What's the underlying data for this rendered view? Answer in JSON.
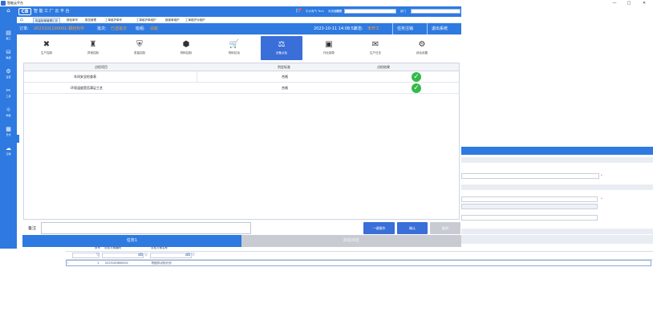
{
  "window": {
    "title": "智能云平台",
    "controls": [
      "—",
      "□",
      "✕"
    ]
  },
  "header": {
    "logo": "CB",
    "app_title": "智 能 工 厂 云 平 台",
    "tenant_text": "中大电气 Tech",
    "lang_text": "系统管理员",
    "org_label": "组织",
    "role_label": "部门"
  },
  "nav": {
    "tabs": [
      {
        "label": "批量制单管理汇总"
      },
      {
        "label": "报检单号"
      },
      {
        "label": "数控管理"
      },
      {
        "label": "工单维护单号"
      },
      {
        "label": "工单维护单维护"
      },
      {
        "label": "报废单维护"
      },
      {
        "label": "工单维护分维护"
      }
    ]
  },
  "status": {
    "order_label": "订单:",
    "order_value": "2023101100001-钢结构件",
    "batch_label": "批次:",
    "batch_value": "已选批次",
    "team_label": "班组:",
    "team_value": "白班",
    "datetime": "2023-10-11 14:08:52",
    "state_label": "状态:",
    "state_value": "未开工",
    "task_logout": "任务注销",
    "exit_system": "退出系统"
  },
  "sidebar": {
    "items": [
      {
        "icon": "⌂",
        "label": ""
      },
      {
        "icon": "▤",
        "label": "报工"
      },
      {
        "icon": "⛁",
        "label": "数据"
      },
      {
        "icon": "⚙",
        "label": "设置"
      },
      {
        "icon": "✂",
        "label": "工具"
      },
      {
        "icon": "☼",
        "label": "参数"
      },
      {
        "icon": "▦",
        "label": "日志"
      },
      {
        "icon": "☁",
        "label": "云端"
      }
    ]
  },
  "tiles": [
    {
      "icon": "✖",
      "label": "生产控制"
    },
    {
      "icon": "♜",
      "label": "异常控制"
    },
    {
      "icon": "⛨",
      "label": "质量控制"
    },
    {
      "icon": "⬢",
      "label": "物料控制"
    },
    {
      "icon": "🛒",
      "label": "物料拉动"
    },
    {
      "icon": "⚖",
      "label": "设备点检"
    },
    {
      "icon": "▣",
      "label": "作业指导"
    },
    {
      "icon": "✉",
      "label": "生产日志"
    },
    {
      "icon": "⚙",
      "label": "综合设置"
    }
  ],
  "table": {
    "columns": [
      "点检项目",
      "判定标准",
      "点检结果"
    ],
    "rows": [
      {
        "item": "车间安全检查表",
        "standard": "合格",
        "result": "ok"
      },
      {
        "item": "环境温度是否满足工艺",
        "standard": "合格",
        "result": "ok"
      }
    ]
  },
  "remark": {
    "label": "备注",
    "value": ""
  },
  "actions": {
    "one_click": "一键操作",
    "confirm": "确认",
    "cancel": "取消"
  },
  "bottom_tabs": {
    "task": "任务1",
    "start": "启动点检"
  },
  "background_window": {
    "col_seq": "序号",
    "col_plan_no": "点检方案编码",
    "col_plan_name": "点检方案名称",
    "row_index": "1",
    "row_code": "2023100800001",
    "row_name": "物品拆点检计划",
    "required_mark": "*"
  },
  "colors": {
    "primary": "#2e7ae0",
    "tile_active": "#3a6ed8",
    "highlight": "#ff9d3b",
    "ok_green": "#34b94a",
    "disabled": "#c8ccd2"
  }
}
